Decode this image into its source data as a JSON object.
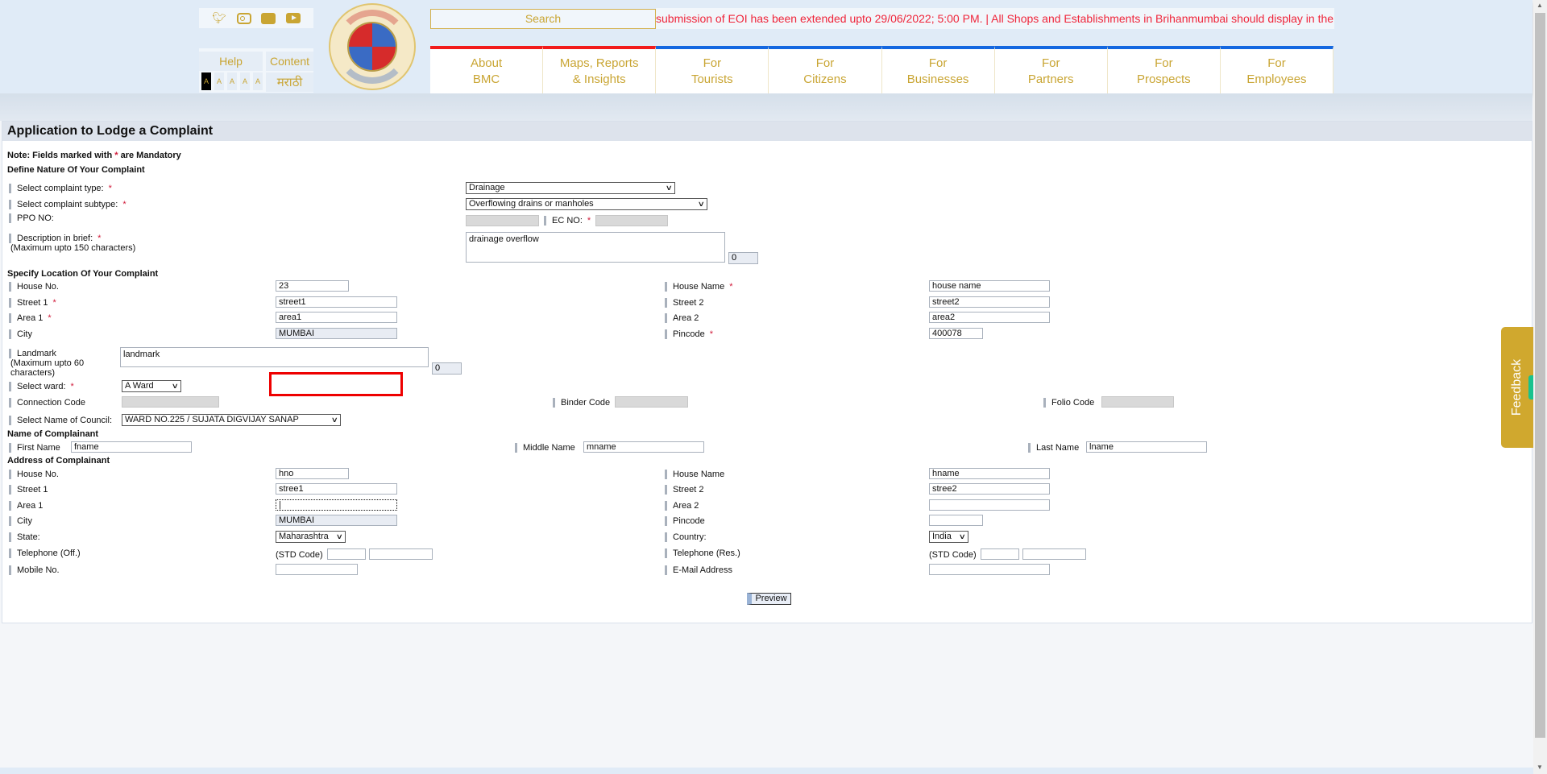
{
  "header": {
    "social_icons": [
      "twitter-icon",
      "instagram-icon",
      "facebook-icon",
      "youtube-icon"
    ],
    "help_label": "Help",
    "content_label": "Content",
    "font_size_buttons": [
      "A",
      "A",
      "A",
      "A",
      "A"
    ],
    "language_label": "मराठी",
    "logo_alt": "Brihanmumbai Municipal Corporation",
    "search_placeholder": "Search",
    "ticker_text": "submission of EOI has been extended upto 29/06/2022; 5:00 PM. | All Shops and Establishments in Brihanmumbai should display in the",
    "nav": [
      {
        "line1": "About",
        "line2": "BMC"
      },
      {
        "line1": "Maps, Reports",
        "line2": "& Insights"
      },
      {
        "line1": "For",
        "line2": "Tourists"
      },
      {
        "line1": "For",
        "line2": "Citizens"
      },
      {
        "line1": "For",
        "line2": "Businesses"
      },
      {
        "line1": "For",
        "line2": "Partners"
      },
      {
        "line1": "For",
        "line2": "Prospects"
      },
      {
        "line1": "For",
        "line2": "Employees"
      }
    ]
  },
  "form": {
    "title": "Application to Lodge a Complaint",
    "note_prefix": "Note: Fields marked with",
    "note_star": "*",
    "note_suffix": "are Mandatory",
    "required_mark": "*",
    "nature": {
      "heading": "Define Nature Of Your Complaint",
      "type_label": "Select complaint type:",
      "type_value": "Drainage",
      "subtype_label": "Select complaint subtype:",
      "subtype_value": "Overflowing drains or manholes",
      "ppo_label": "PPO NO:",
      "ppo_value": "",
      "ec_label": "EC NO:",
      "ec_value": "",
      "desc_label": "Description in brief:",
      "desc_hint": "(Maximum upto 150 characters)",
      "desc_value": "drainage overflow",
      "desc_counter": "0"
    },
    "location": {
      "heading": "Specify Location Of Your Complaint",
      "house_no_label": "House No.",
      "house_no_value": "23",
      "house_name_label": "House Name",
      "house_name_value": "house name",
      "street1_label": "Street 1",
      "street1_value": "street1",
      "street2_label": "Street 2",
      "street2_value": "street2",
      "area1_label": "Area 1",
      "area1_value": "area1",
      "area2_label": "Area 2",
      "area2_value": "area2",
      "city_label": "City",
      "city_value": "MUMBAI",
      "pincode_label": "Pincode",
      "pincode_value": "400078",
      "landmark_label": "Landmark",
      "landmark_hint1": "(Maximum upto 60",
      "landmark_hint2": "characters)",
      "landmark_value": "landmark",
      "landmark_counter": "0",
      "ward_label": "Select ward:",
      "ward_value": "A Ward",
      "connection_label": "Connection Code",
      "connection_value": "",
      "binder_label": "Binder Code",
      "binder_value": "",
      "folio_label": "Folio Code",
      "folio_value": "",
      "council_label": "Select Name of Council:",
      "council_value": "WARD NO.225 / SUJATA DIGVIJAY SANAP"
    },
    "complainant": {
      "heading": "Name of Complainant",
      "first_label": "First Name",
      "first_value": "fname",
      "middle_label": "Middle Name",
      "middle_value": "mname",
      "last_label": "Last Name",
      "last_value": "lname"
    },
    "address": {
      "heading": "Address of Complainant",
      "house_no_label": "House No.",
      "house_no_value": "hno",
      "house_name_label": "House Name",
      "house_name_value": "hname",
      "street1_label": "Street 1",
      "street1_value": "stree1",
      "street2_label": "Street 2",
      "street2_value": "stree2",
      "area1_label": "Area 1",
      "area1_value": "|",
      "area2_label": "Area 2",
      "area2_value": "",
      "city_label": "City",
      "city_value": "MUMBAI",
      "pincode_label": "Pincode",
      "pincode_value": "",
      "state_label": "State:",
      "state_value": "Maharashtra",
      "country_label": "Country:",
      "country_value": "India",
      "tel_off_label": "Telephone (Off.)",
      "tel_res_label": "Telephone (Res.)",
      "std_label": "(STD Code)",
      "mobile_label": "Mobile No.",
      "mobile_value": "",
      "email_label": "E-Mail Address",
      "email_value": ""
    },
    "preview_label": "Preview"
  },
  "feedback_label": "Feedback",
  "colors": {
    "brand_gold": "#c9a533",
    "nav_blue": "#1467e0",
    "nav_red": "#f21b1b",
    "ticker_red": "#f0253a",
    "required_red": "#d11b3a",
    "feedback_gold": "#d0a82e"
  }
}
